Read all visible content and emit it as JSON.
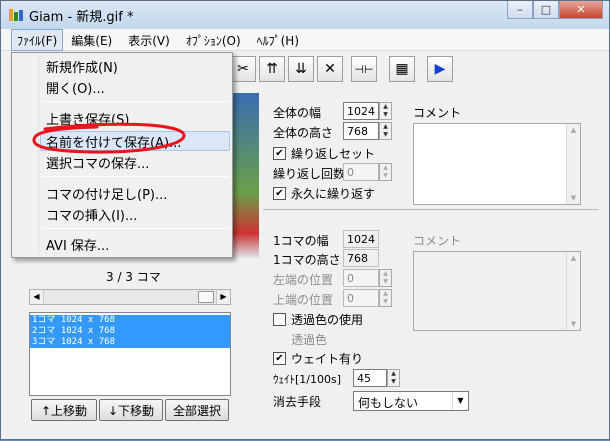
{
  "window": {
    "title": "Giam - 新規.gif *",
    "minimize": "–",
    "maximize": "□",
    "close": "✕"
  },
  "menubar": [
    "ﾌｧｲﾙ(F)",
    "編集(E)",
    "表示(V)",
    "ｵﾌﾟｼｮﾝ(O)",
    "ﾍﾙﾌﾟ(H)"
  ],
  "file_menu": {
    "items": [
      "新規作成(N)",
      "開く(O)...",
      "上書き保存(S)",
      "名前を付けて保存(A)...",
      "選択コマの保存...",
      "コマの付け足し(P)...",
      "コマの挿入(I)...",
      "AVI 保存..."
    ],
    "highlighted_index": 3
  },
  "toolbar": {
    "icons": [
      "cut-icon",
      "move-frame-up-icon",
      "move-frame-down-icon",
      "delete-icon",
      "fit-frame-icon",
      "grid-icon",
      "play-icon"
    ],
    "glyphs": [
      "✂",
      "⇈",
      "⇊",
      "✕",
      "⊣⊢",
      "▦",
      "▶"
    ]
  },
  "left": {
    "frame_counter": "3 / 3 コマ",
    "frames": [
      "1コマ 1024 x 768",
      "2コマ 1024 x 768",
      "3コマ 1024 x 768"
    ],
    "buttons": [
      "↑上移動",
      "↓下移動",
      "全部選択"
    ]
  },
  "global": {
    "width_label": "全体の幅",
    "width_value": "1024",
    "height_label": "全体の高さ",
    "height_value": "768",
    "loop_set_label": "繰り返しセット",
    "loop_set_checked": true,
    "loop_count_label": "繰り返し回数",
    "loop_count_value": "0",
    "loop_forever_label": "永久に繰り返す",
    "loop_forever_checked": true,
    "comment_label": "コメント"
  },
  "frame": {
    "width_label": "1コマの幅",
    "width_value": "1024",
    "height_label": "1コマの高さ",
    "height_value": "768",
    "left_label": "左端の位置",
    "left_value": "0",
    "top_label": "上端の位置",
    "top_value": "0",
    "transparent_label": "透過色の使用",
    "transparent_checked": false,
    "transparent_color_label": "透過色",
    "wait_label": "ウェイト有り",
    "wait_checked": true,
    "wait_time_label": "ｳｪｲﾄ[1/100s]",
    "wait_time_value": "45",
    "dispose_label": "消去手段",
    "dispose_value": "何もしない",
    "comment_label": "コメント"
  },
  "colors": {
    "selection": "#3399ff",
    "annotation": "#e8141e",
    "play": "#1a3fd0"
  }
}
